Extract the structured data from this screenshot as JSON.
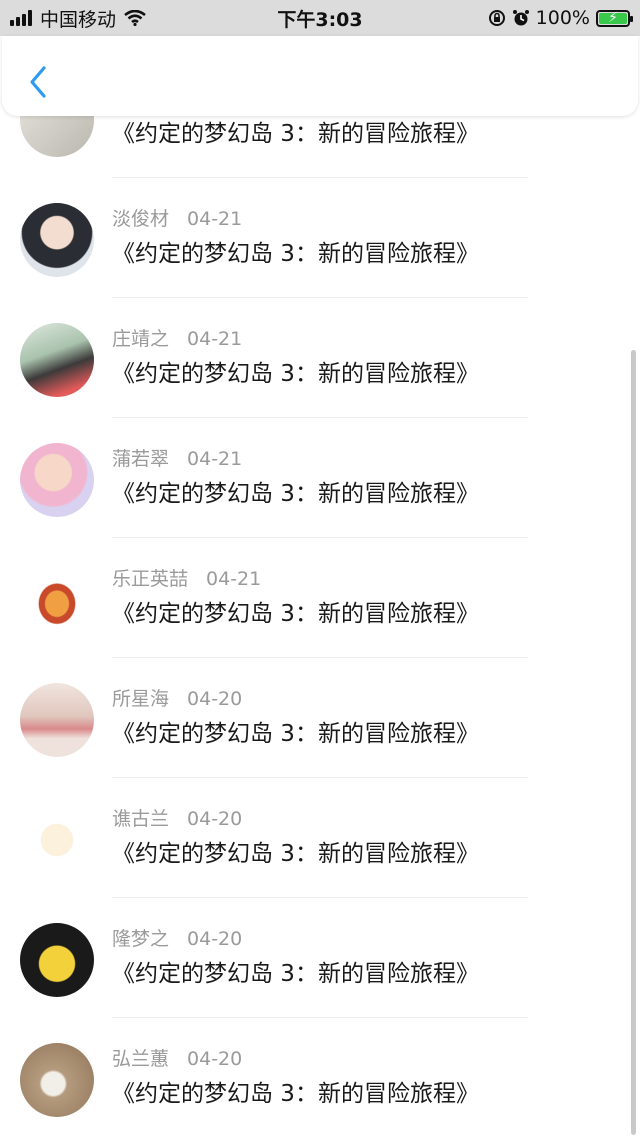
{
  "status_bar": {
    "carrier": "中国移动",
    "time": "下午3:03",
    "battery": "100%"
  },
  "header": {
    "back_icon": "chevron-left-icon"
  },
  "list": {
    "items": [
      {
        "name": "",
        "date": "",
        "title": "《约定的梦幻岛 3：新的冒险旅程》",
        "avatar_color": "#cfcfc8"
      },
      {
        "name": "淡俊材",
        "date": "04-21",
        "title": "《约定的梦幻岛 3：新的冒险旅程》",
        "avatar_color": "#3a3f48"
      },
      {
        "name": "庄靖之",
        "date": "04-21",
        "title": "《约定的梦幻岛 3：新的冒险旅程》",
        "avatar_color": "#b9c9bd"
      },
      {
        "name": "蒲若翠",
        "date": "04-21",
        "title": "《约定的梦幻岛 3：新的冒险旅程》",
        "avatar_color": "#e9c8d8"
      },
      {
        "name": "乐正英喆",
        "date": "04-21",
        "title": "《约定的梦幻岛 3：新的冒险旅程》",
        "avatar_color": "#f2a24a"
      },
      {
        "name": "所星海",
        "date": "04-20",
        "title": "《约定的梦幻岛 3：新的冒险旅程》",
        "avatar_color": "#e2c9c4"
      },
      {
        "name": "谯古兰",
        "date": "04-20",
        "title": "《约定的梦幻岛 3：新的冒险旅程》",
        "avatar_color": "#f7e6c9"
      },
      {
        "name": "隆梦之",
        "date": "04-20",
        "title": "《约定的梦幻岛 3：新的冒险旅程》",
        "avatar_color": "#f2d33a"
      },
      {
        "name": "弘兰蕙",
        "date": "04-20",
        "title": "《约定的梦幻岛 3：新的冒险旅程》",
        "avatar_color": "#b79e82"
      }
    ]
  }
}
